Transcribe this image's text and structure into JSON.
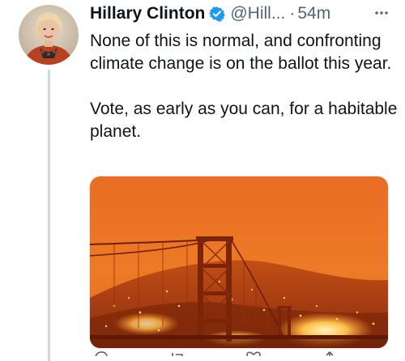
{
  "tweet": {
    "author_name": "Hillary Clinton",
    "handle": "@Hill...",
    "separator": "·",
    "timestamp": "54m",
    "paragraphs": [
      "None of this is normal, and confronting climate change is on the ballot this year.",
      "Vote, as early as you can, for a habitable planet."
    ]
  },
  "icons": {
    "verified": "verified-badge-icon",
    "more": "more-options-icon",
    "reply": "reply-icon",
    "retweet": "retweet-icon",
    "like": "like-icon",
    "share": "share-icon"
  },
  "colors": {
    "verified_blue": "#1d9bf0",
    "secondary_text": "#536471",
    "primary_text": "#0f1419",
    "thread_line": "#cfd9de"
  }
}
